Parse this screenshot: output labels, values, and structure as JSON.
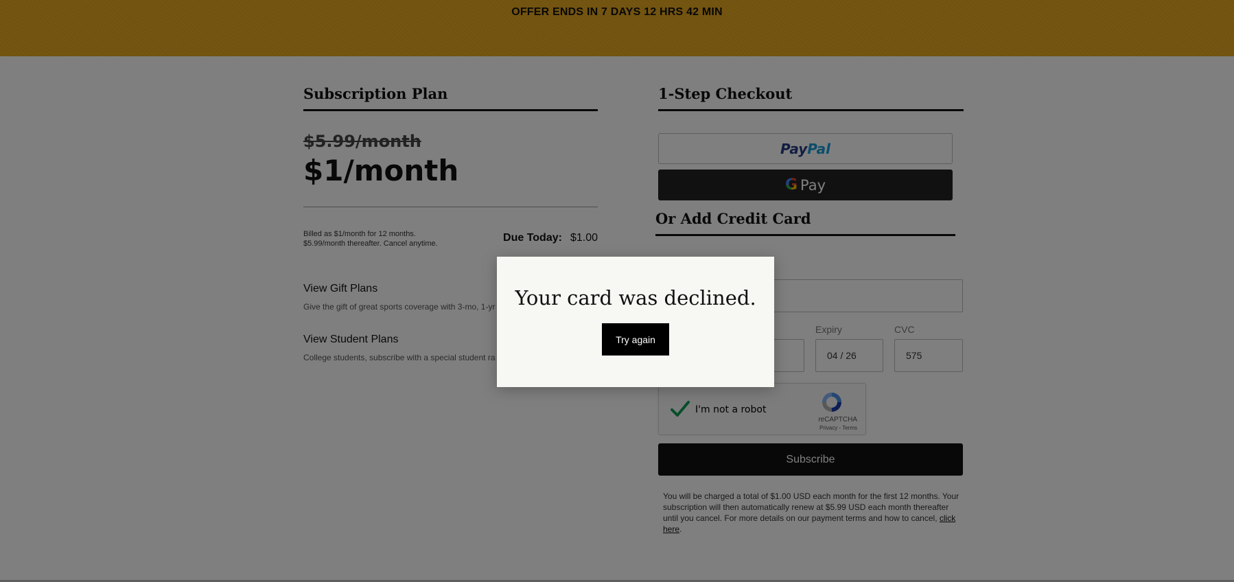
{
  "banner": {
    "text": "OFFER ENDS IN 7 DAYS 12 HRS 42 MIN"
  },
  "plan": {
    "title": "Subscription Plan",
    "old_price": "$5.99/month",
    "new_price": "$1/month",
    "billing_line1": "Billed as $1/month for 12 months.",
    "billing_line2": "$5.99/month thereafter. Cancel anytime.",
    "due_label": "Due Today:",
    "due_amount": "$1.00",
    "gift_link": "View Gift Plans",
    "gift_desc": "Give the gift of great sports coverage with 3-mo, 1-yr",
    "student_link": "View Student Plans",
    "student_desc": "College students, subscribe with a special student ra"
  },
  "checkout": {
    "title": "1-Step Checkout",
    "paypal_part1": "Pay",
    "paypal_part2": "Pal",
    "gpay_g": "G",
    "gpay_text": "Pay",
    "cc_title": "Or Add Credit Card",
    "card_number_value": "",
    "expiry_label": "Expiry",
    "expiry_value": "04 / 26",
    "cvc_label": "CVC",
    "cvc_value": "575",
    "captcha_label": "I'm not a robot",
    "captcha_brand": "reCAPTCHA",
    "captcha_links": "Privacy - Terms",
    "subscribe_label": "Subscribe",
    "fine_print": "You will be charged a total of $1.00 USD each month for the first 12 months. Your subscription will then automatically renew at $5.99 USD each month thereafter until you cancel. For more details on our payment terms and how to cancel, ",
    "fine_print_link": "click here",
    "fine_print_end": "."
  },
  "modal": {
    "title": "Your card was declined.",
    "button": "Try again"
  },
  "colors": {
    "banner": "#e9a91e",
    "overlay": "rgba(0,0,0,0.5)",
    "modal_bg": "#f7f7f3"
  }
}
